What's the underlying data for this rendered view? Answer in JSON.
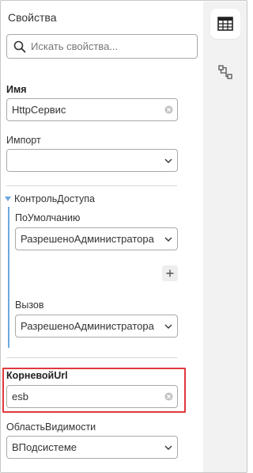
{
  "panel": {
    "title": "Свойства",
    "search_placeholder": "Искать свойства..."
  },
  "properties": {
    "name": {
      "label": "Имя",
      "value": "HttpСервис"
    },
    "import": {
      "label": "Импорт",
      "value": ""
    },
    "access_control": {
      "label": "КонтрольДоступа",
      "default": {
        "label": "ПоУмолчанию",
        "value": "РазрешеноАдминистратора"
      },
      "call": {
        "label": "Вызов",
        "value": "РазрешеноАдминистратора"
      }
    },
    "root_url": {
      "label": "КорневойUrl",
      "value": "esb"
    },
    "scope": {
      "label": "ОбластьВидимости",
      "value": "ВПодсистеме"
    }
  },
  "colors": {
    "accent_line": "#6ea8e0",
    "highlight_border": "#e0393e"
  },
  "icons": {
    "search": "search-icon",
    "clear": "clear-circle-icon",
    "chevron": "chevron-down-icon",
    "plus": "plus-icon",
    "table": "table-icon",
    "diagram": "diagram-icon",
    "collapse": "caret-down-icon"
  }
}
